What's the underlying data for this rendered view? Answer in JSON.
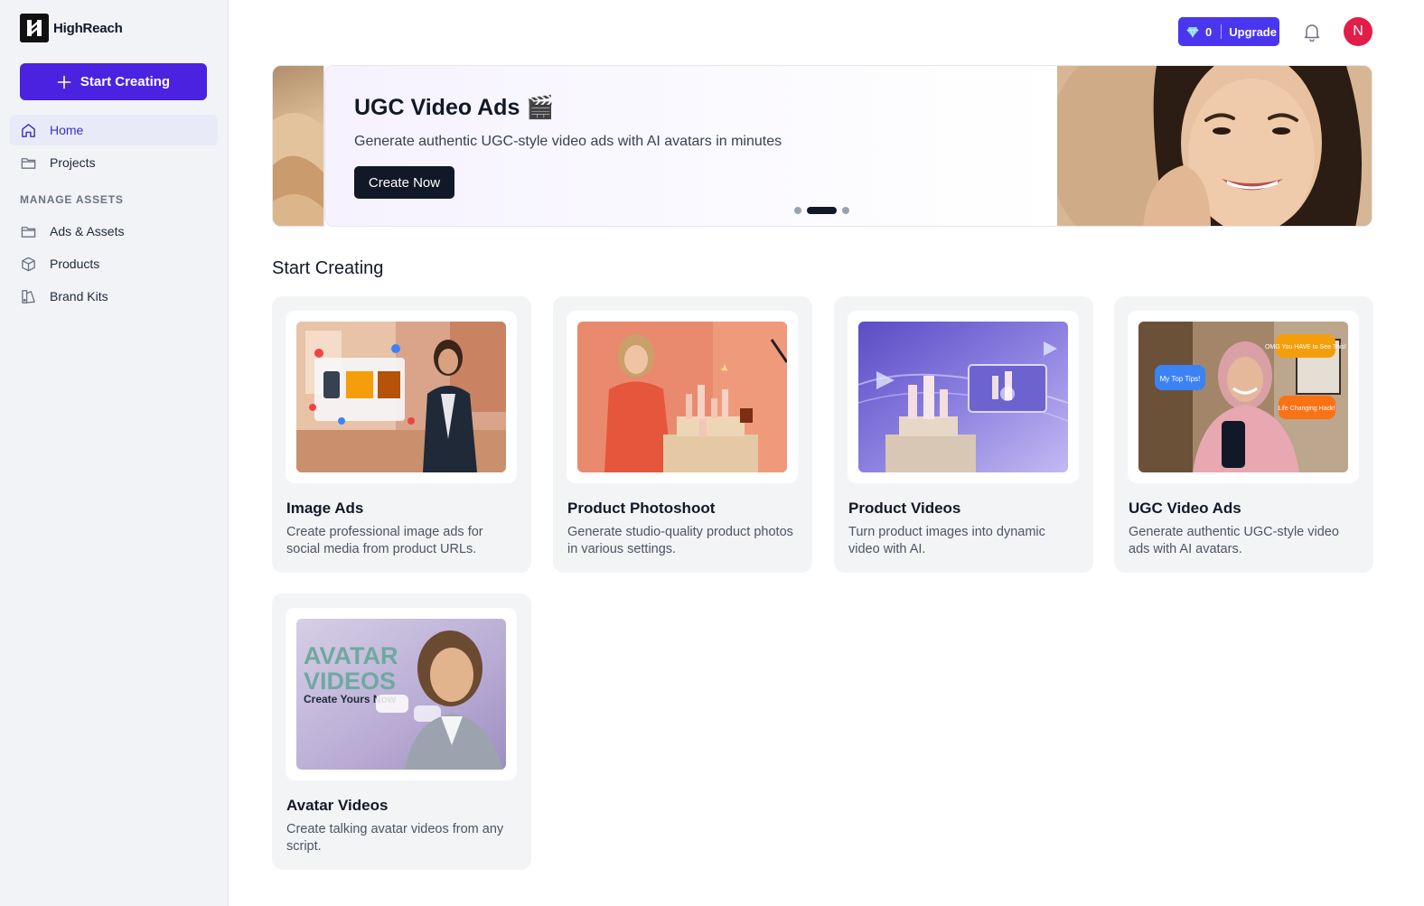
{
  "brand": {
    "name": "HighReach"
  },
  "sidebar": {
    "start_label": "Start Creating",
    "nav": [
      {
        "label": "Home",
        "icon": "home-icon",
        "active": true
      },
      {
        "label": "Projects",
        "icon": "folder-icon"
      }
    ],
    "section_label": "MANAGE ASSETS",
    "assets": [
      {
        "label": "Ads & Assets",
        "icon": "folder-icon"
      },
      {
        "label": "Products",
        "icon": "box-icon"
      },
      {
        "label": "Brand Kits",
        "icon": "brand-kit-icon"
      }
    ]
  },
  "topbar": {
    "credits": "0",
    "upgrade_label": "Upgrade",
    "avatar_initial": "N",
    "colors": {
      "accent": "#4a36ef",
      "avatar": "#e11d48"
    }
  },
  "banner": {
    "title": "UGC Video Ads 🎬",
    "subtitle": "Generate authentic UGC-style video ads with AI avatars in minutes",
    "cta": "Create Now",
    "slide_count": 3,
    "active_slide": 2
  },
  "main": {
    "section_title": "Start Creating",
    "cards": [
      {
        "title": "Image Ads",
        "desc": "Create professional image ads for social media from product URLs."
      },
      {
        "title": "Product Photoshoot",
        "desc": "Generate studio-quality product photos in various settings."
      },
      {
        "title": "Product Videos",
        "desc": "Turn product images into dynamic video with AI."
      },
      {
        "title": "UGC Video Ads",
        "desc": "Generate authentic UGC-style video ads with AI avatars.",
        "bubbles": [
          "OMG You HAVE to See This!",
          "My Top Tips!",
          "Life Changing Hack!"
        ]
      },
      {
        "title": "Avatar Videos",
        "desc": "Create talking avatar videos from any script.",
        "overlay": {
          "line1": "AVATAR",
          "line2": "VIDEOS",
          "line3": "Create Yours Now"
        }
      }
    ]
  }
}
